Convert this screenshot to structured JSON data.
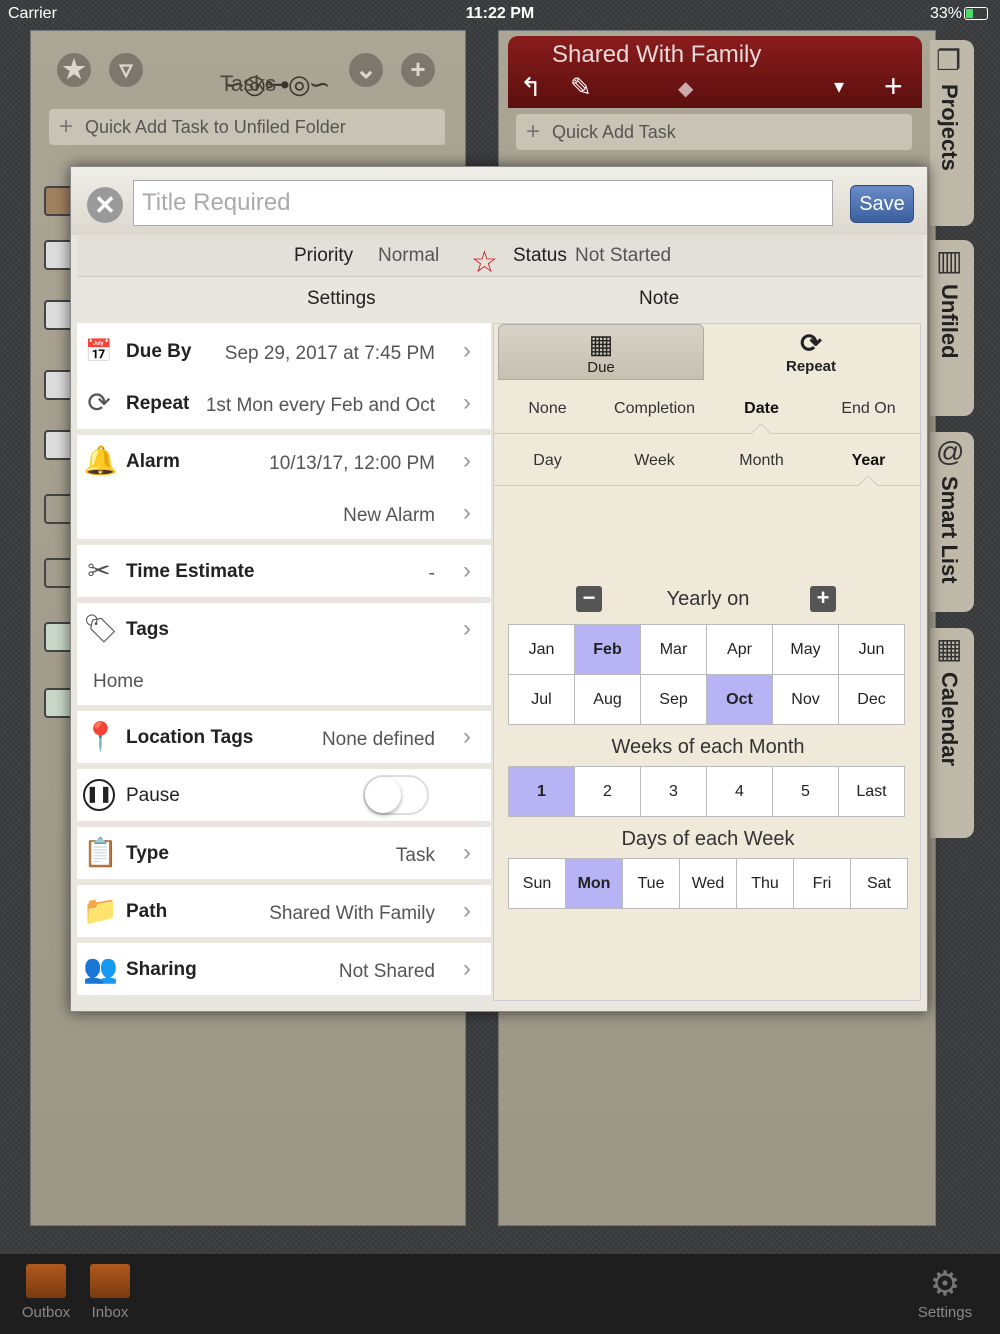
{
  "status_bar": {
    "carrier": "Carrier",
    "time": "11:22 PM",
    "battery": "33%"
  },
  "left_panel": {
    "title": "Tasks",
    "quick_add": "Quick Add Task to Unfiled Folder"
  },
  "right_panel": {
    "title": "Shared With Family",
    "quick_add": "Quick Add Task"
  },
  "side_tabs": [
    "Projects",
    "Unfiled",
    "Smart List",
    "Calendar"
  ],
  "bottom_bar": {
    "outbox": "Outbox",
    "inbox": "Inbox",
    "settings": "Settings"
  },
  "dialog": {
    "title_placeholder": "Title Required",
    "save_label": "Save",
    "priority_label": "Priority",
    "priority_value": "Normal",
    "status_label": "Status",
    "status_value": "Not Started",
    "tab_settings": "Settings",
    "tab_note": "Note",
    "rows": {
      "due_label": "Due By",
      "due_value": "Sep 29, 2017 at 7:45 PM",
      "repeat_label": "Repeat",
      "repeat_value": "1st Mon every Feb and Oct",
      "alarm_label": "Alarm",
      "alarm_value": "10/13/17, 12:00 PM",
      "new_alarm": "New Alarm",
      "time_label": "Time Estimate",
      "time_value": "-",
      "tags_label": "Tags",
      "tags_value": "Home",
      "location_label": "Location Tags",
      "location_value": "None defined",
      "pause_label": "Pause",
      "type_label": "Type",
      "type_value": "Task",
      "path_label": "Path",
      "path_value": "Shared With Family",
      "sharing_label": "Sharing",
      "sharing_value": "Not Shared"
    }
  },
  "repeat_panel": {
    "tab_due": "Due",
    "tab_repeat": "Repeat",
    "mode_options": [
      "None",
      "Completion",
      "Date",
      "End On"
    ],
    "mode_selected": "Date",
    "unit_options": [
      "Day",
      "Week",
      "Month",
      "Year"
    ],
    "unit_selected": "Year",
    "yearly_label": "Yearly on",
    "months": [
      "Jan",
      "Feb",
      "Mar",
      "Apr",
      "May",
      "Jun",
      "Jul",
      "Aug",
      "Sep",
      "Oct",
      "Nov",
      "Dec"
    ],
    "months_selected": [
      "Feb",
      "Oct"
    ],
    "weeks_label": "Weeks of each Month",
    "weeks": [
      "1",
      "2",
      "3",
      "4",
      "5",
      "Last"
    ],
    "weeks_selected": [
      "1"
    ],
    "days_label": "Days of each Week",
    "days": [
      "Sun",
      "Mon",
      "Tue",
      "Wed",
      "Thu",
      "Fri",
      "Sat"
    ],
    "days_selected": [
      "Mon"
    ]
  },
  "colors": {
    "selection": "#b7b3f5",
    "header_red": "#7a1515",
    "save_blue": "#4a6fae",
    "star_red": "#c8161b"
  }
}
